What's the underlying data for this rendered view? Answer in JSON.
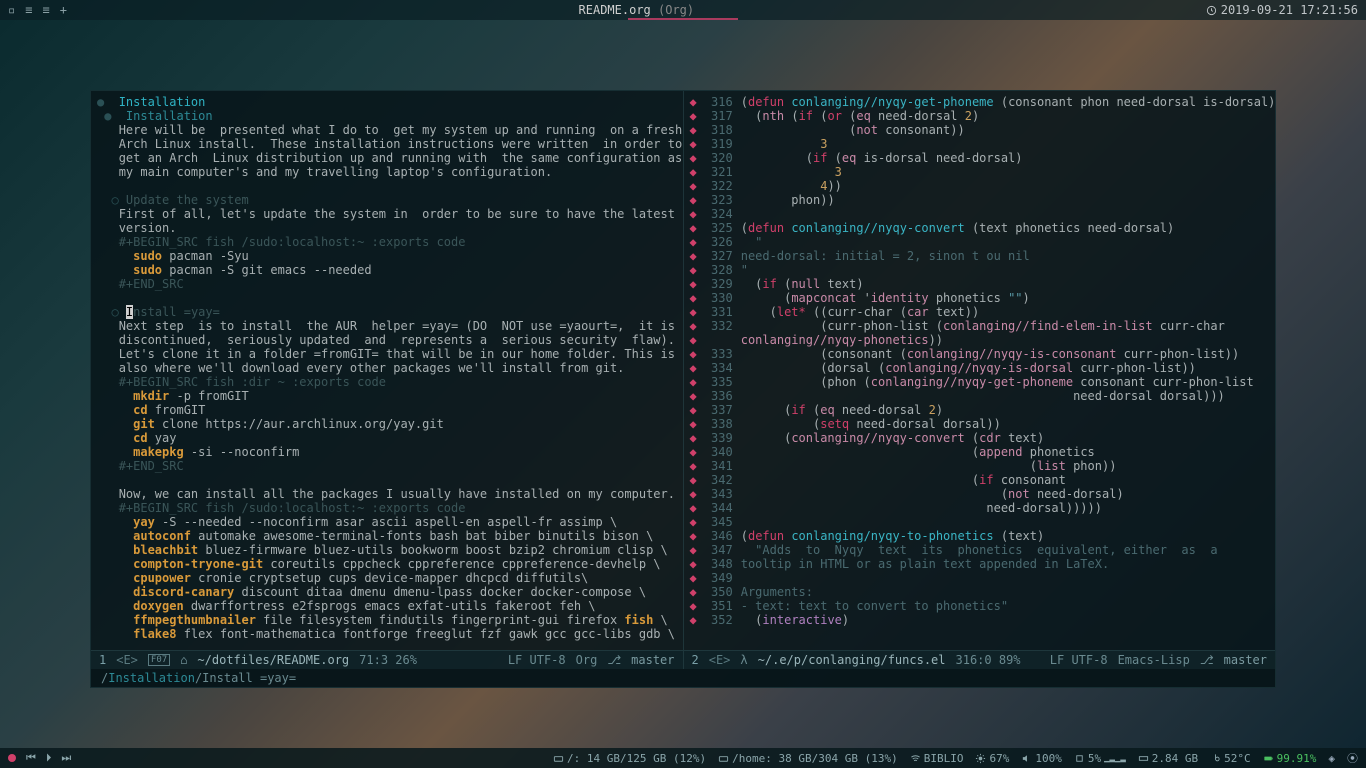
{
  "titlebar": {
    "left_icons": [
      "▫",
      "≡",
      "≡",
      "+"
    ],
    "title": "README.org",
    "mode": "(Org)",
    "datetime": "2019-09-21 17:21:56"
  },
  "left_pane": {
    "headings": {
      "h1": "Installation",
      "h2": "Installation",
      "h3a": "Update the system",
      "h3b": "Install =yay="
    },
    "body1": [
      "Here will be  presented what I do to  get my system up and running  on a fresh",
      "Arch Linux install.  These installation instructions were written  in order to",
      "get an Arch  Linux distribution up and running with  the same configuration as",
      "my main computer's and my travelling laptop's configuration."
    ],
    "body2": [
      "First of all, let's update the system in  order to be sure to have the latest",
      "version."
    ],
    "src1_begin": "#+BEGIN_SRC fish /sudo:localhost:~ :exports code",
    "src1_lines": [
      {
        "kw": "sudo",
        "rest": " pacman -Syu"
      },
      {
        "kw": "sudo",
        "rest": " pacman -S git emacs --needed"
      }
    ],
    "src_end": "#+END_SRC",
    "body3": [
      "Next step  is to install  the AUR  helper =yay= (DO  NOT use =yaourt=,  it is",
      "discontinued,  seriously updated  and  represents a  serious security  flaw).",
      "Let's clone it in a folder =fromGIT= that will be in our home folder. This is",
      "also where we'll download every other packages we'll install from git."
    ],
    "src2_begin": "#+BEGIN_SRC fish :dir ~ :exports code",
    "src2_lines": [
      {
        "kw": "mkdir",
        "rest": " -p fromGIT"
      },
      {
        "kw": "cd",
        "rest": " fromGIT"
      },
      {
        "kw": "git",
        "rest": " clone https://aur.archlinux.org/yay.git"
      },
      {
        "kw": "cd",
        "rest": " yay"
      },
      {
        "kw": "makepkg",
        "rest": " -si --noconfirm"
      }
    ],
    "body4": "Now, we can install all the packages I usually have installed on my computer.",
    "src3_begin": "#+BEGIN_SRC fish /sudo:localhost:~ :exports code",
    "pkg_lines": [
      {
        "kw": "yay",
        "rest": " -S --needed --noconfirm asar ascii aspell-en aspell-fr assimp \\"
      },
      {
        "kw": "autoconf",
        "rest": " automake awesome-terminal-fonts bash bat biber binutils bison \\"
      },
      {
        "kw": "bleachbit",
        "rest": " bluez-firmware bluez-utils bookworm boost bzip2 chromium clisp \\"
      },
      {
        "kw": "compton-tryone-git",
        "rest": " coreutils cppcheck cppreference cppreference-devhelp \\"
      },
      {
        "kw": "cpupower",
        "rest": " cronie cryptsetup cups device-mapper dhcpcd diffutils\\"
      },
      {
        "kw": "discord-canary",
        "rest": " discount ditaa dmenu dmenu-lpass docker docker-compose \\"
      },
      {
        "kw": "doxygen",
        "rest": " dwarffortress e2fsprogs emacs exfat-utils fakeroot feh \\"
      },
      {
        "kw": "ffmpegthumbnailer",
        "rest": " file filesystem findutils fingerprint-gui firefox ",
        "kw2": "fish",
        "rest2": " \\"
      },
      {
        "kw": "flake8",
        "rest": " flex font-mathematica fontforge freeglut fzf gawk gcc gcc-libs gdb \\"
      }
    ]
  },
  "right_pane": {
    "lines": [
      {
        "n": 316,
        "raw": [
          {
            "t": "(",
            "c": "txt"
          },
          {
            "t": "defun",
            "c": "pink"
          },
          {
            "t": " ",
            "c": "txt"
          },
          {
            "t": "conlanging//nyqy-get-phoneme",
            "c": "cyan"
          },
          {
            "t": " (",
            "c": "txt"
          },
          {
            "t": "consonant phon need-dorsal is-dorsal",
            "c": "txt"
          },
          {
            "t": ")",
            "c": "txt"
          }
        ]
      },
      {
        "n": 317,
        "raw": [
          {
            "t": "  (",
            "c": "txt"
          },
          {
            "t": "nth",
            "c": "fn"
          },
          {
            "t": " (",
            "c": "txt"
          },
          {
            "t": "if",
            "c": "pink"
          },
          {
            "t": " (",
            "c": "txt"
          },
          {
            "t": "or",
            "c": "pink"
          },
          {
            "t": " (",
            "c": "txt"
          },
          {
            "t": "eq",
            "c": "fn"
          },
          {
            "t": " need-dorsal ",
            "c": "txt"
          },
          {
            "t": "2",
            "c": "num"
          },
          {
            "t": ")",
            "c": "txt"
          }
        ]
      },
      {
        "n": 318,
        "raw": [
          {
            "t": "               (",
            "c": "txt"
          },
          {
            "t": "not",
            "c": "fn"
          },
          {
            "t": " consonant",
            "c": "txt"
          },
          {
            "t": "))",
            "c": "txt"
          }
        ]
      },
      {
        "n": 319,
        "raw": [
          {
            "t": "           ",
            "c": "txt"
          },
          {
            "t": "3",
            "c": "num"
          }
        ]
      },
      {
        "n": 320,
        "raw": [
          {
            "t": "         (",
            "c": "txt"
          },
          {
            "t": "if",
            "c": "pink"
          },
          {
            "t": " (",
            "c": "txt"
          },
          {
            "t": "eq",
            "c": "fn"
          },
          {
            "t": " is-dorsal need-dorsal",
            "c": "txt"
          },
          {
            "t": ")",
            "c": "txt"
          }
        ]
      },
      {
        "n": 321,
        "raw": [
          {
            "t": "             ",
            "c": "txt"
          },
          {
            "t": "3",
            "c": "num"
          }
        ]
      },
      {
        "n": 322,
        "raw": [
          {
            "t": "           ",
            "c": "txt"
          },
          {
            "t": "4",
            "c": "num"
          },
          {
            "t": "))",
            "c": "txt"
          }
        ]
      },
      {
        "n": 323,
        "raw": [
          {
            "t": "       phon",
            "c": "txt"
          },
          {
            "t": "))",
            "c": "txt"
          }
        ]
      },
      {
        "n": 324,
        "raw": [
          {
            "t": "",
            "c": "txt"
          }
        ]
      },
      {
        "n": 325,
        "raw": [
          {
            "t": "(",
            "c": "txt"
          },
          {
            "t": "defun",
            "c": "pink"
          },
          {
            "t": " ",
            "c": "txt"
          },
          {
            "t": "conlanging//nyqy-convert",
            "c": "cyan"
          },
          {
            "t": " (",
            "c": "txt"
          },
          {
            "t": "text phonetics need-dorsal",
            "c": "txt"
          },
          {
            "t": ")",
            "c": "txt"
          }
        ]
      },
      {
        "n": 326,
        "raw": [
          {
            "t": "  \"",
            "c": "comment"
          }
        ]
      },
      {
        "n": 327,
        "raw": [
          {
            "t": "need-dorsal: initial = 2, sinon t ou nil",
            "c": "comment"
          }
        ]
      },
      {
        "n": 328,
        "raw": [
          {
            "t": "\"",
            "c": "comment"
          }
        ]
      },
      {
        "n": 329,
        "raw": [
          {
            "t": "  (",
            "c": "txt"
          },
          {
            "t": "if",
            "c": "pink"
          },
          {
            "t": " (",
            "c": "txt"
          },
          {
            "t": "null",
            "c": "fn"
          },
          {
            "t": " text",
            "c": "txt"
          },
          {
            "t": ")",
            "c": "txt"
          }
        ]
      },
      {
        "n": 330,
        "raw": [
          {
            "t": "      (",
            "c": "txt"
          },
          {
            "t": "mapconcat",
            "c": "fn"
          },
          {
            "t": " '",
            "c": "txt"
          },
          {
            "t": "identity",
            "c": "fn"
          },
          {
            "t": " phonetics ",
            "c": "txt"
          },
          {
            "t": "\"\"",
            "c": "str"
          },
          {
            "t": ")",
            "c": "txt"
          }
        ]
      },
      {
        "n": 331,
        "raw": [
          {
            "t": "    (",
            "c": "txt"
          },
          {
            "t": "let*",
            "c": "pink"
          },
          {
            "t": " ((",
            "c": "txt"
          },
          {
            "t": "curr-char (",
            "c": "txt"
          },
          {
            "t": "car",
            "c": "fn"
          },
          {
            "t": " text",
            "c": "txt"
          },
          {
            "t": "))",
            "c": "txt"
          }
        ]
      },
      {
        "n": 332,
        "raw": [
          {
            "t": "           (curr-phon-list (",
            "c": "txt"
          },
          {
            "t": "conlanging//find-elem-in-list",
            "c": "fn"
          },
          {
            "t": " curr-char",
            "c": "txt"
          }
        ]
      },
      {
        "n": 0,
        "cont": true,
        "raw": [
          {
            "t": "conlanging//nyqy-phonetics",
            "c": "fn"
          },
          {
            "t": "))",
            "c": "txt"
          }
        ]
      },
      {
        "n": 333,
        "raw": [
          {
            "t": "           (consonant (",
            "c": "txt"
          },
          {
            "t": "conlanging//nyqy-is-consonant",
            "c": "fn"
          },
          {
            "t": " curr-phon-list",
            "c": "txt"
          },
          {
            "t": "))",
            "c": "txt"
          }
        ]
      },
      {
        "n": 334,
        "raw": [
          {
            "t": "           (dorsal (",
            "c": "txt"
          },
          {
            "t": "conlanging//nyqy-is-dorsal",
            "c": "fn"
          },
          {
            "t": " curr-phon-list",
            "c": "txt"
          },
          {
            "t": "))",
            "c": "txt"
          }
        ]
      },
      {
        "n": 335,
        "raw": [
          {
            "t": "           (phon (",
            "c": "txt"
          },
          {
            "t": "conlanging//nyqy-get-phoneme",
            "c": "fn"
          },
          {
            "t": " consonant curr-phon-list",
            "c": "txt"
          }
        ]
      },
      {
        "n": 336,
        "raw": [
          {
            "t": "                                              need-dorsal dorsal",
            "c": "txt"
          },
          {
            "t": ")))",
            "c": "txt"
          }
        ]
      },
      {
        "n": 337,
        "raw": [
          {
            "t": "      (",
            "c": "txt"
          },
          {
            "t": "if",
            "c": "pink"
          },
          {
            "t": " (",
            "c": "txt"
          },
          {
            "t": "eq",
            "c": "fn"
          },
          {
            "t": " need-dorsal ",
            "c": "txt"
          },
          {
            "t": "2",
            "c": "num"
          },
          {
            "t": ")",
            "c": "txt"
          }
        ]
      },
      {
        "n": 338,
        "raw": [
          {
            "t": "          (",
            "c": "txt"
          },
          {
            "t": "setq",
            "c": "pink"
          },
          {
            "t": " need-dorsal dorsal",
            "c": "txt"
          },
          {
            "t": "))",
            "c": "txt"
          }
        ]
      },
      {
        "n": 339,
        "raw": [
          {
            "t": "      (",
            "c": "txt"
          },
          {
            "t": "conlanging//nyqy-convert",
            "c": "fn"
          },
          {
            "t": " (",
            "c": "txt"
          },
          {
            "t": "cdr",
            "c": "fn"
          },
          {
            "t": " text",
            "c": "txt"
          },
          {
            "t": ")",
            "c": "txt"
          }
        ]
      },
      {
        "n": 340,
        "raw": [
          {
            "t": "                                (",
            "c": "txt"
          },
          {
            "t": "append",
            "c": "fn"
          },
          {
            "t": " phonetics",
            "c": "txt"
          }
        ]
      },
      {
        "n": 341,
        "raw": [
          {
            "t": "                                        (",
            "c": "txt"
          },
          {
            "t": "list",
            "c": "fn"
          },
          {
            "t": " phon",
            "c": "txt"
          },
          {
            "t": "))",
            "c": "txt"
          }
        ]
      },
      {
        "n": 342,
        "raw": [
          {
            "t": "                                (",
            "c": "txt"
          },
          {
            "t": "if",
            "c": "pink"
          },
          {
            "t": " consonant",
            "c": "txt"
          }
        ]
      },
      {
        "n": 343,
        "raw": [
          {
            "t": "                                    (",
            "c": "txt"
          },
          {
            "t": "not",
            "c": "fn"
          },
          {
            "t": " need-dorsal",
            "c": "txt"
          },
          {
            "t": ")",
            "c": "txt"
          }
        ]
      },
      {
        "n": 344,
        "raw": [
          {
            "t": "                                  need-dorsal",
            "c": "txt"
          },
          {
            "t": ")))))",
            "c": "txt"
          }
        ]
      },
      {
        "n": 345,
        "raw": [
          {
            "t": "",
            "c": "txt"
          }
        ]
      },
      {
        "n": 346,
        "raw": [
          {
            "t": "(",
            "c": "txt"
          },
          {
            "t": "defun",
            "c": "pink"
          },
          {
            "t": " ",
            "c": "txt"
          },
          {
            "t": "conlanging/nyqy-to-phonetics",
            "c": "cyan"
          },
          {
            "t": " (",
            "c": "txt"
          },
          {
            "t": "text",
            "c": "txt"
          },
          {
            "t": ")",
            "c": "txt"
          }
        ]
      },
      {
        "n": 347,
        "raw": [
          {
            "t": "  \"Adds  to  Nyqy  text  its  phonetics  equivalent, either  as  a",
            "c": "comment"
          }
        ]
      },
      {
        "n": 348,
        "raw": [
          {
            "t": "tooltip in HTML or as plain text appended in LaTeX.",
            "c": "comment"
          }
        ]
      },
      {
        "n": 349,
        "raw": [
          {
            "t": "",
            "c": "comment"
          }
        ]
      },
      {
        "n": 350,
        "raw": [
          {
            "t": "Arguments:",
            "c": "comment"
          }
        ]
      },
      {
        "n": 351,
        "raw": [
          {
            "t": "- text: text to convert to phonetics\"",
            "c": "comment"
          }
        ]
      },
      {
        "n": 352,
        "raw": [
          {
            "t": "  (",
            "c": "txt"
          },
          {
            "t": "interactive",
            "c": "purple"
          },
          {
            "t": ")",
            "c": "txt"
          }
        ]
      }
    ]
  },
  "modeline_left": {
    "num": "1",
    "state": "<E>",
    "icon": "F07",
    "path": "~/dotfiles/README.org",
    "pos": "71:3 26%",
    "eol": "LF UTF-8",
    "mode": "Org",
    "branch": "master"
  },
  "modeline_right": {
    "num": "2",
    "state": "<E>",
    "path": "~/.e/p/conlanging/funcs.el",
    "pos": "316:0 89%",
    "eol": "LF UTF-8",
    "mode": "Emacs-Lisp",
    "branch": "master"
  },
  "minibuffer": {
    "crumb1": "Installation",
    "crumb2": "Install =yay="
  },
  "taskbar": {
    "disk_root": "/: 14 GB/125 GB (12%)",
    "disk_home": "/home: 38 GB/304 GB (13%)",
    "wifi": "BIBLIO",
    "brightness": "67%",
    "volume": "100%",
    "cpu": "5%",
    "ram": "2.84 GB",
    "temp": "52°C",
    "battery": "99.91%"
  }
}
